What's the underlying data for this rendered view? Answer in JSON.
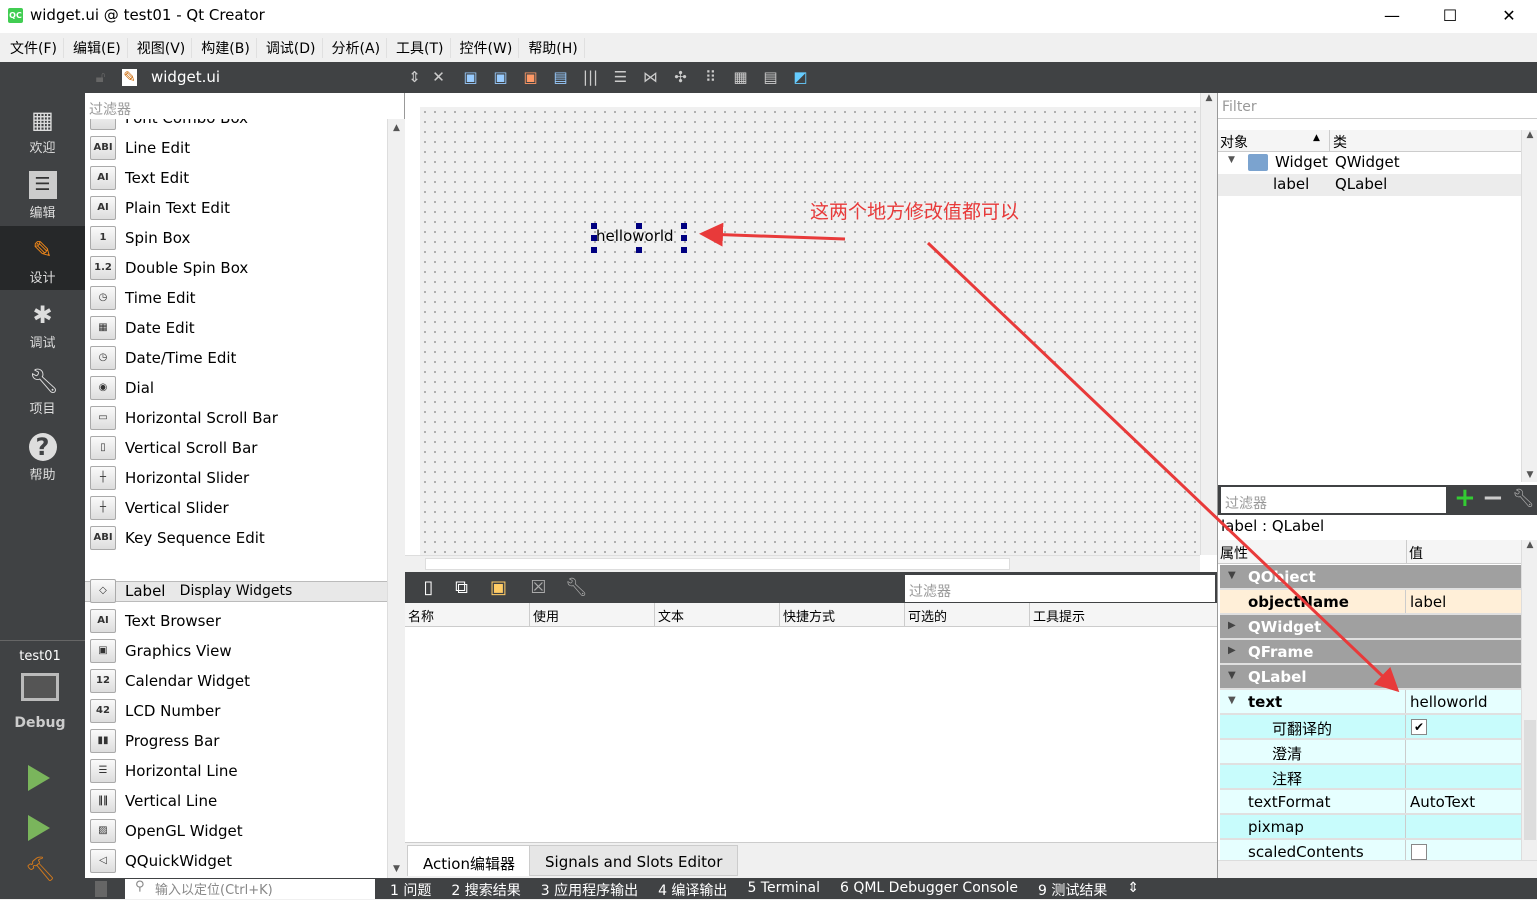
{
  "window": {
    "title": "widget.ui @ test01 - Qt Creator",
    "app_icon": "QC"
  },
  "menu": [
    "文件(F)",
    "编辑(E)",
    "视图(V)",
    "构建(B)",
    "调试(D)",
    "分析(A)",
    "工具(T)",
    "控件(W)",
    "帮助(H)"
  ],
  "toolbar": {
    "file_name": "widget.ui"
  },
  "modes": [
    {
      "label": "欢迎",
      "icon": "grid-icon"
    },
    {
      "label": "编辑",
      "icon": "document-icon"
    },
    {
      "label": "设计",
      "icon": "pencil-icon",
      "selected": true
    },
    {
      "label": "调试",
      "icon": "bug-icon"
    },
    {
      "label": "项目",
      "icon": "wrench-icon"
    },
    {
      "label": "帮助",
      "icon": "help-icon"
    }
  ],
  "kit": {
    "project": "test01",
    "config": "Debug"
  },
  "widgetbox": {
    "filter_placeholder": "过滤器",
    "partial_item": "Font Combo Box",
    "input_items": [
      {
        "label": "Line Edit",
        "icon": "ABI"
      },
      {
        "label": "Text Edit",
        "icon": "AI"
      },
      {
        "label": "Plain Text Edit",
        "icon": "AI"
      },
      {
        "label": "Spin Box",
        "icon": "1"
      },
      {
        "label": "Double Spin Box",
        "icon": "1.2"
      },
      {
        "label": "Time Edit",
        "icon": "◷"
      },
      {
        "label": "Date Edit",
        "icon": "▦"
      },
      {
        "label": "Date/Time Edit",
        "icon": "◷"
      },
      {
        "label": "Dial",
        "icon": "◉"
      },
      {
        "label": "Horizontal Scroll Bar",
        "icon": "▭"
      },
      {
        "label": "Vertical Scroll Bar",
        "icon": "▯"
      },
      {
        "label": "Horizontal Slider",
        "icon": "┼"
      },
      {
        "label": "Vertical Slider",
        "icon": "┼"
      },
      {
        "label": "Key Sequence Edit",
        "icon": "ABI"
      }
    ],
    "category": "Display Widgets",
    "display_items": [
      {
        "label": "Label",
        "icon": "◇"
      },
      {
        "label": "Text Browser",
        "icon": "AI"
      },
      {
        "label": "Graphics View",
        "icon": "▣"
      },
      {
        "label": "Calendar Widget",
        "icon": "12"
      },
      {
        "label": "LCD Number",
        "icon": "42"
      },
      {
        "label": "Progress Bar",
        "icon": "▮▮"
      },
      {
        "label": "Horizontal Line",
        "icon": "☰"
      },
      {
        "label": "Vertical Line",
        "icon": "‖‖"
      },
      {
        "label": "OpenGL Widget",
        "icon": "▨"
      },
      {
        "label": "QQuickWidget",
        "icon": "◁"
      }
    ]
  },
  "canvas": {
    "label_text": "helloworld"
  },
  "annotation": {
    "text": "这两个地方修改值都可以",
    "color": "#e83a3a"
  },
  "action_editor": {
    "filter_placeholder": "过滤器",
    "columns": [
      "名称",
      "使用",
      "文本",
      "快捷方式",
      "可选的",
      "工具提示"
    ],
    "tabs": [
      "Action编辑器",
      "Signals and Slots Editor"
    ]
  },
  "object_inspector": {
    "filter_placeholder": "Filter",
    "columns": [
      "对象",
      "类"
    ],
    "rows": [
      {
        "object": "Widget",
        "class": "QWidget"
      },
      {
        "object": "label",
        "class": "QLabel"
      }
    ]
  },
  "property_editor": {
    "filter_placeholder": "过滤器",
    "context": "label : QLabel",
    "columns": [
      "属性",
      "值"
    ],
    "rows": [
      {
        "name": "QObject",
        "type": "group",
        "expanded": true
      },
      {
        "name": "objectName",
        "value": "label",
        "bold": true
      },
      {
        "name": "QWidget",
        "type": "group",
        "expanded": false
      },
      {
        "name": "QFrame",
        "type": "group",
        "expanded": false
      },
      {
        "name": "QLabel",
        "type": "group",
        "expanded": true
      },
      {
        "name": "text",
        "value": "helloworld",
        "bold": true,
        "expanded": true
      },
      {
        "name": "可翻译的",
        "checked": true,
        "sub": true
      },
      {
        "name": "澄清",
        "value": "",
        "sub": true
      },
      {
        "name": "注释",
        "value": "",
        "sub": true
      },
      {
        "name": "textFormat",
        "value": "AutoText"
      },
      {
        "name": "pixmap",
        "value": ""
      },
      {
        "name": "scaledContents",
        "checked": false
      }
    ]
  },
  "statusbar": {
    "locator_placeholder": "输入以定位(Ctrl+K)",
    "outputs": [
      "1 问题",
      "2 搜索结果",
      "3 应用程序输出",
      "4 编译输出",
      "5 Terminal",
      "6 QML Debugger Console",
      "9 测试结果"
    ]
  }
}
